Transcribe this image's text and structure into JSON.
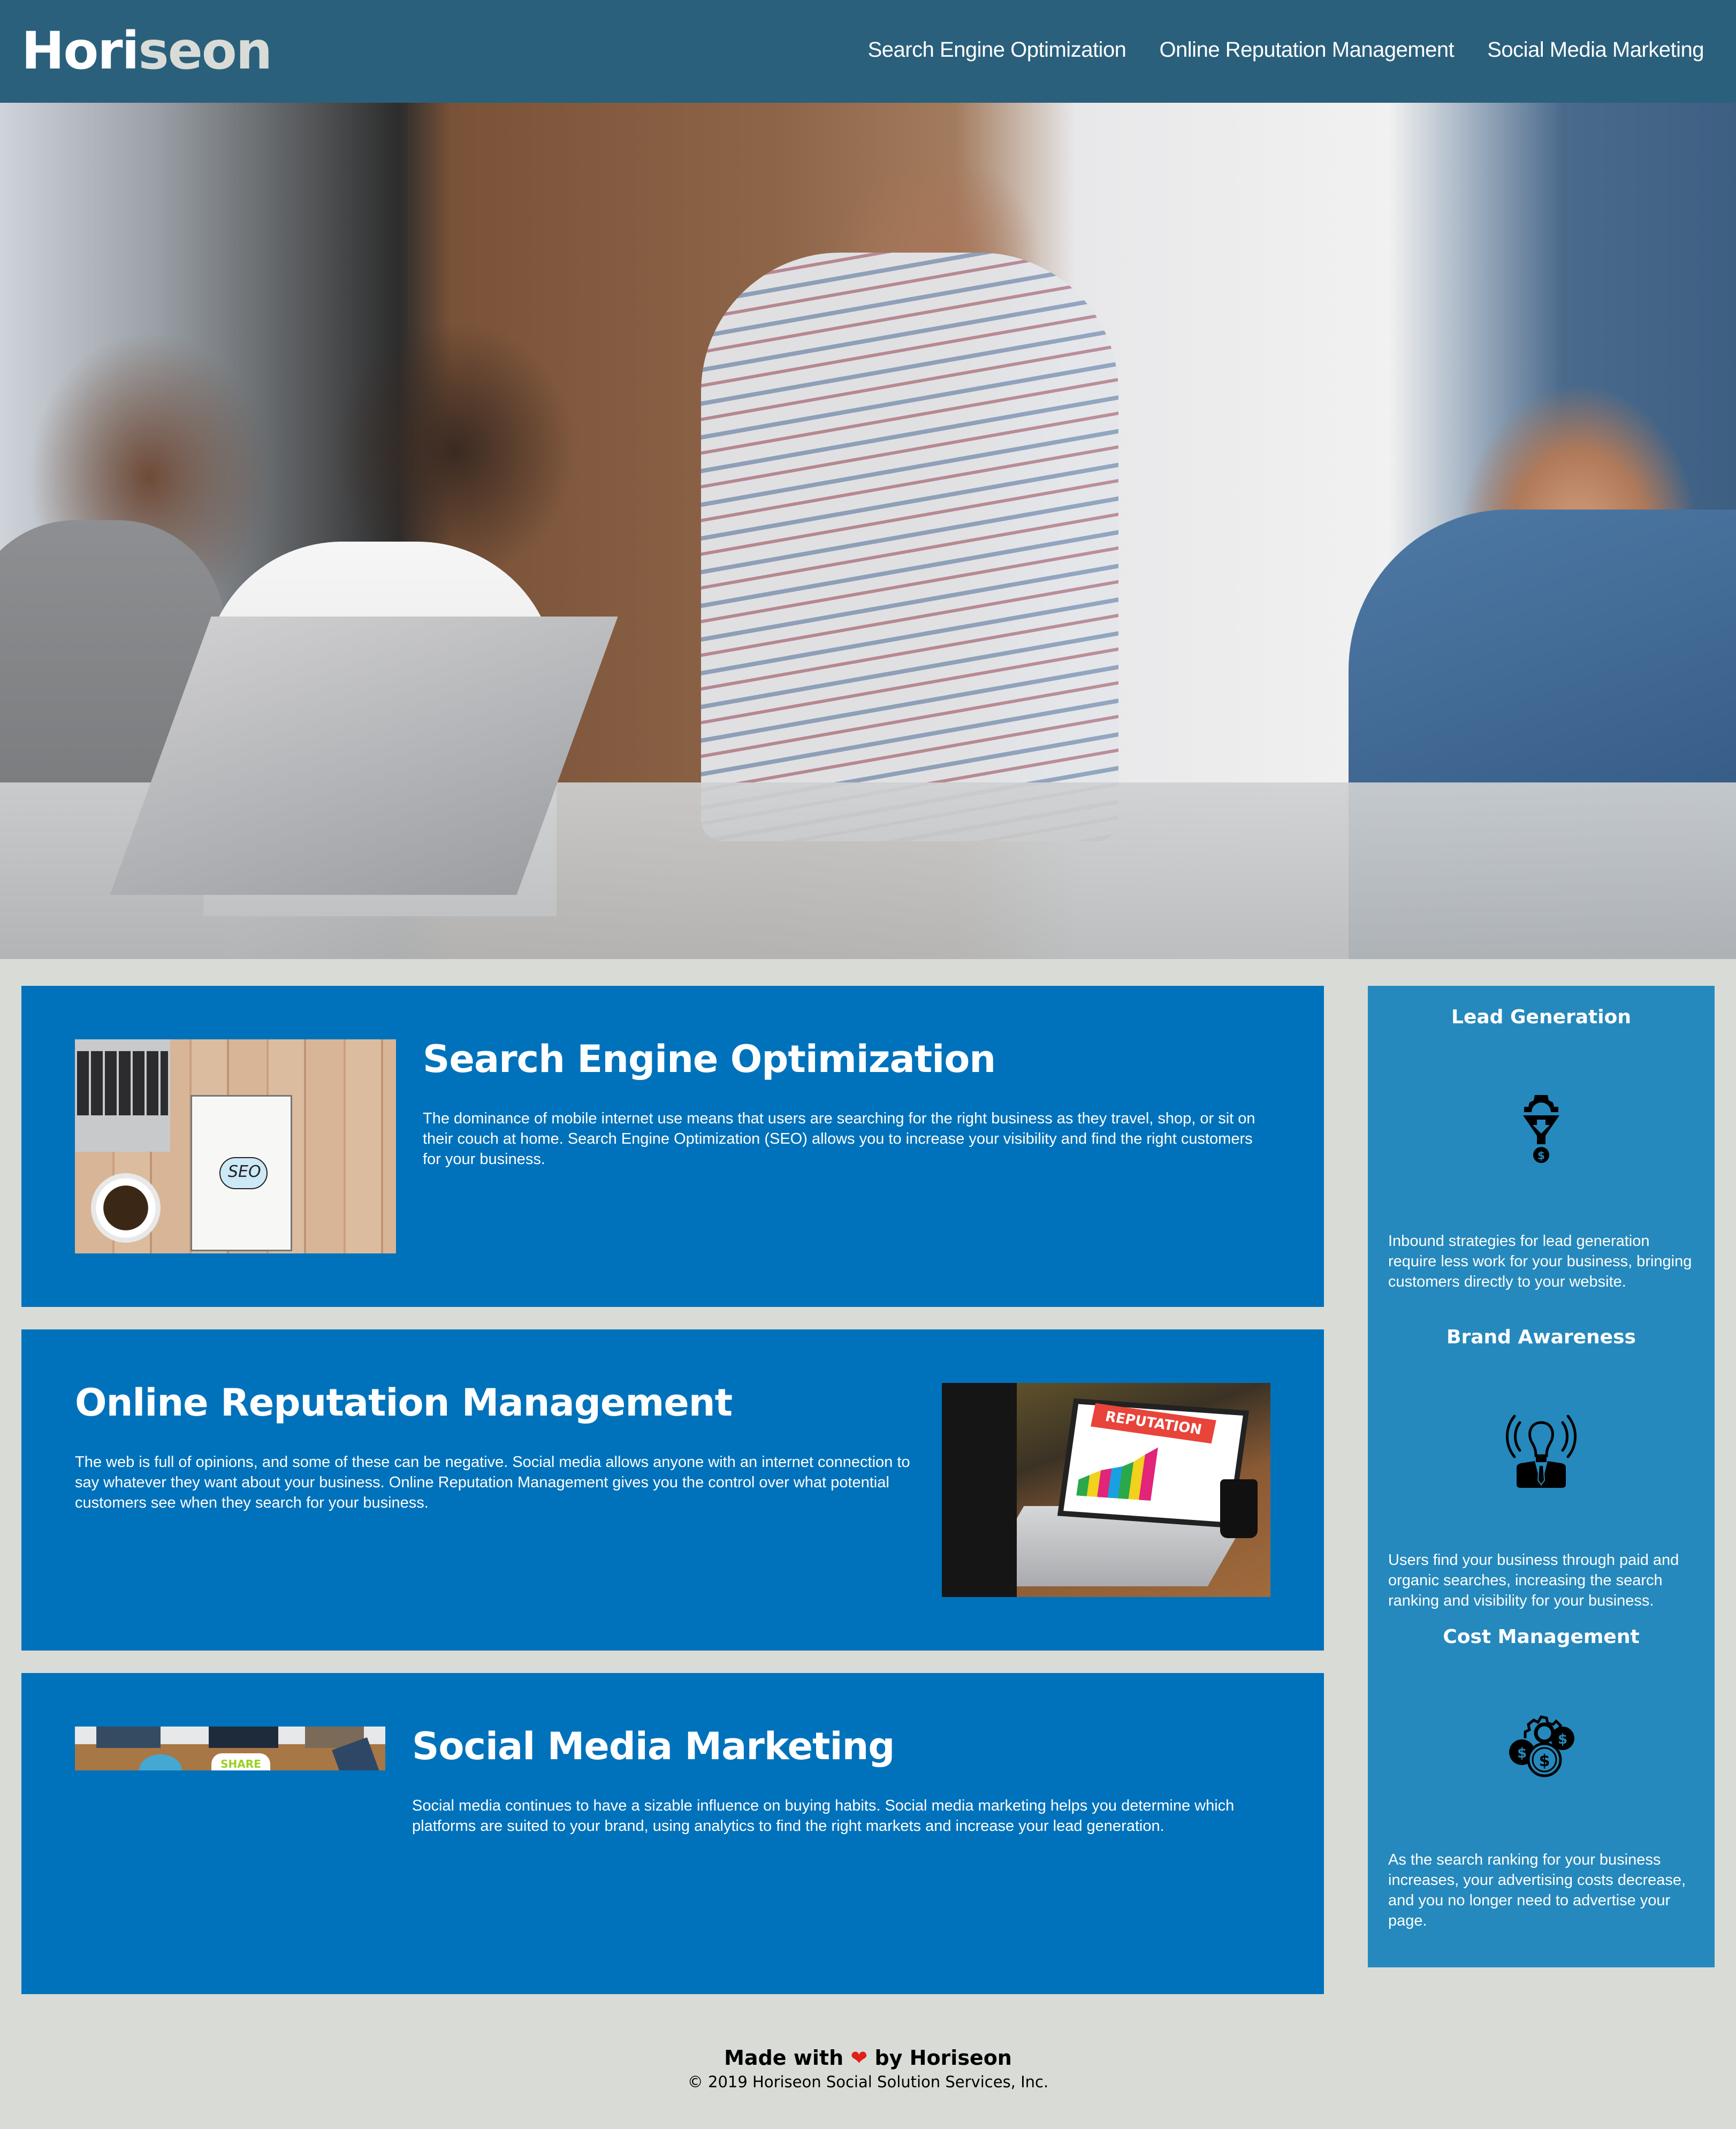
{
  "header": {
    "logo_main": "Hori",
    "logo_accent": "seon",
    "nav": [
      {
        "label": "Search Engine Optimization"
      },
      {
        "label": "Online Reputation Management"
      },
      {
        "label": "Social Media Marketing"
      }
    ]
  },
  "hero": {
    "image": "team-meeting-photo"
  },
  "content": [
    {
      "title": "Search Engine Optimization",
      "body": "The dominance of mobile internet use means that users are searching for the right business as they travel, shop, or sit on their couch at home. Search Engine Optimization (SEO) allows you to increase your visibility and find the right customers for your business.",
      "image_label": "SEO"
    },
    {
      "title": "Online Reputation Management",
      "body": "The web is full of opinions, and some of these can be negative. Social media allows anyone with an internet connection to say whatever they want about your business. Online Reputation Management gives you the control over what potential customers see when they search for your business.",
      "image_label": "REPUTATION"
    },
    {
      "title": "Social Media Marketing",
      "body": "Social media continues to have a sizable influence on buying habits. Social media marketing helps you determine which platforms are suited to your brand, using analytics to find the right markets and increase your lead generation.",
      "image_label": "SHARE"
    }
  ],
  "benefits": [
    {
      "title": "Lead Generation",
      "icon": "funnel-gear-dollar-icon",
      "body": "Inbound strategies for lead generation require less work for your business, bringing customers directly to your website."
    },
    {
      "title": "Brand Awareness",
      "icon": "lightbulb-person-icon",
      "body": "Users find your business through paid and organic searches, increasing the search ranking and visibility for your business."
    },
    {
      "title": "Cost Management",
      "icon": "gear-coins-icon",
      "body": "As the search ranking for your business increases, your advertising costs decrease, and you no longer need to advertise your page."
    }
  ],
  "footer": {
    "made_prefix": "Made with",
    "heart": "❤",
    "made_suffix": "by Horiseon",
    "copyright": "© 2019 Horiseon Social Solution Services, Inc."
  },
  "colors": {
    "header_bg": "#2a607c",
    "page_bg": "#d9dcd6",
    "card_bg": "#0072bb",
    "sidebar_bg": "#2589bd"
  }
}
